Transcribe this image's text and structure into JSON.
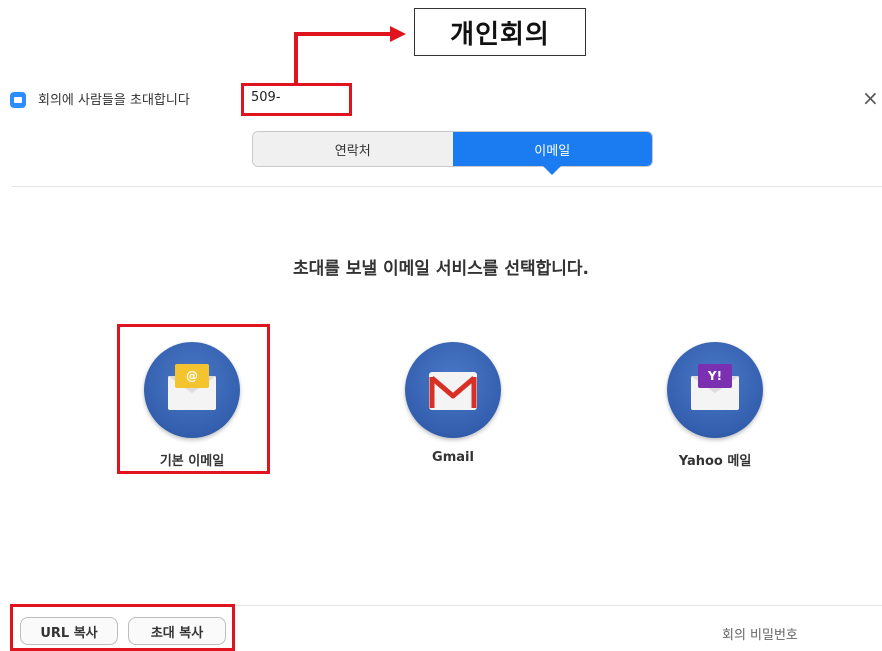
{
  "annotation": {
    "callout_text": "개인회의"
  },
  "window": {
    "title": "회의에 사람들을 초대합니다",
    "meeting_id": "509-",
    "close_symbol": "×"
  },
  "tabs": [
    {
      "label": "연락처",
      "active": false
    },
    {
      "label": "이메일",
      "active": true
    }
  ],
  "main": {
    "heading": "초대를 보낼 이메일 서비스를 선택합니다.",
    "options": [
      {
        "label": "기본 이메일",
        "icon": "default-email-icon",
        "letter": "@"
      },
      {
        "label": "Gmail",
        "icon": "gmail-icon"
      },
      {
        "label": "Yahoo 메일",
        "icon": "yahoo-mail-icon",
        "letter": "Y!"
      }
    ]
  },
  "footer": {
    "copy_url": "URL 복사",
    "copy_invite": "초대 복사",
    "passcode_label": "회의 비밀번호"
  },
  "colors": {
    "accent": "#1a7cf0",
    "annotation_red": "#e0141e",
    "icon_circle": "#335fae"
  }
}
